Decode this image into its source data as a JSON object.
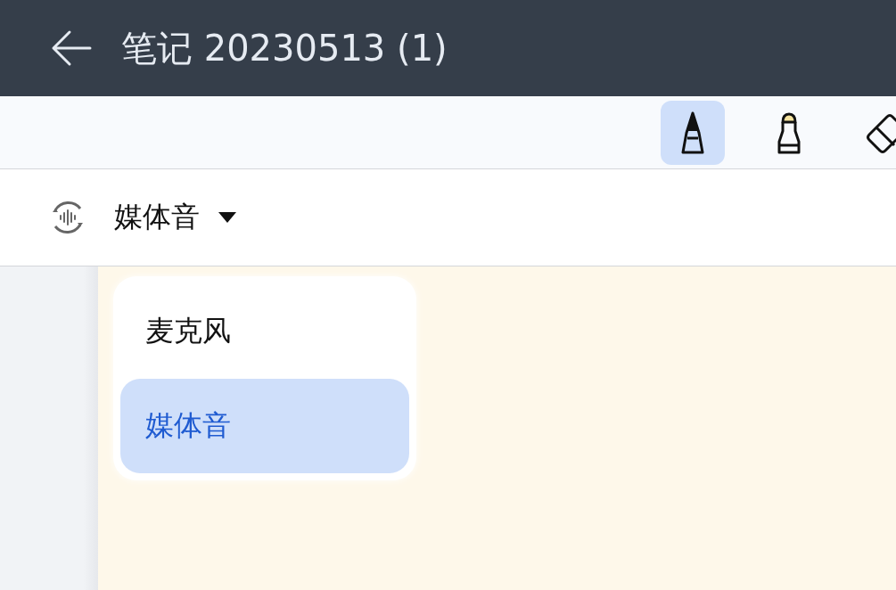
{
  "header": {
    "title": "笔记 20230513 (1)"
  },
  "tools": [
    {
      "kind": "pen",
      "selected": true
    },
    {
      "kind": "highlighter",
      "selected": false
    },
    {
      "kind": "eraser",
      "selected": false
    }
  ],
  "source": {
    "label": "媒体音"
  },
  "source_menu": {
    "items": [
      {
        "label": "麦克风",
        "selected": false
      },
      {
        "label": "媒体音",
        "selected": true
      }
    ]
  }
}
